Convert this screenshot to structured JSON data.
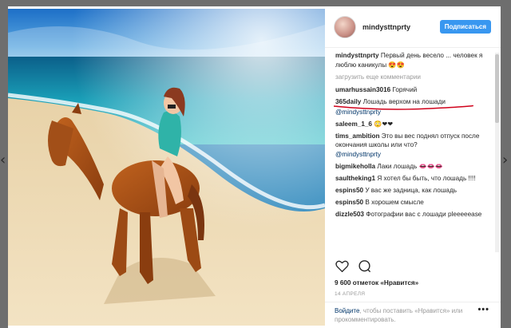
{
  "post": {
    "username": "mindysttnprty",
    "follow_label": "Подписаться"
  },
  "comments": [
    {
      "user": "mindysttnprty",
      "text": "Первый день весело ... человек я люблю каникулы 😍😍"
    },
    {
      "user": "umarhussain3016",
      "text": "Горячий"
    },
    {
      "user": "365daily",
      "text": "Лошадь верхом на лошади"
    },
    {
      "user": "",
      "mention": "@mindysttnprty"
    },
    {
      "user": "saleem_1_6",
      "text": "😳❤❤"
    },
    {
      "user": "tims_ambition",
      "text": "Это вы вес поднял отпуск после окончания школы или что?",
      "mention": "@mindysttnprty"
    },
    {
      "user": "bigmikeholla",
      "text": "Лаки лошадь 👄👄👄"
    },
    {
      "user": "saultheking1",
      "text": "Я хотел бы быть, что лошадь !!!!"
    },
    {
      "user": "espins50",
      "text": "У вас же задница, как лошадь"
    },
    {
      "user": "espins50",
      "text": "В хорошем смысле"
    },
    {
      "user": "dizzle503",
      "text": "Фотографии вас с лошади pleeeeease"
    }
  ],
  "load_more_label": "загрузить еще комментарии",
  "likes": "9 600 отметок «Нравится»",
  "date": "14 АПРЕЛЯ",
  "login": {
    "link": "Войдите",
    "text": ", чтобы поставить «Нравится» или прокомментировать."
  },
  "icons": {
    "like": "heart-icon",
    "comment": "comment-icon",
    "options": "more-options-icon",
    "prev": "chevron-left-icon",
    "next": "chevron-right-icon"
  },
  "colors": {
    "accent": "#3897f0",
    "link": "#003569",
    "annotation": "#d0021b"
  }
}
